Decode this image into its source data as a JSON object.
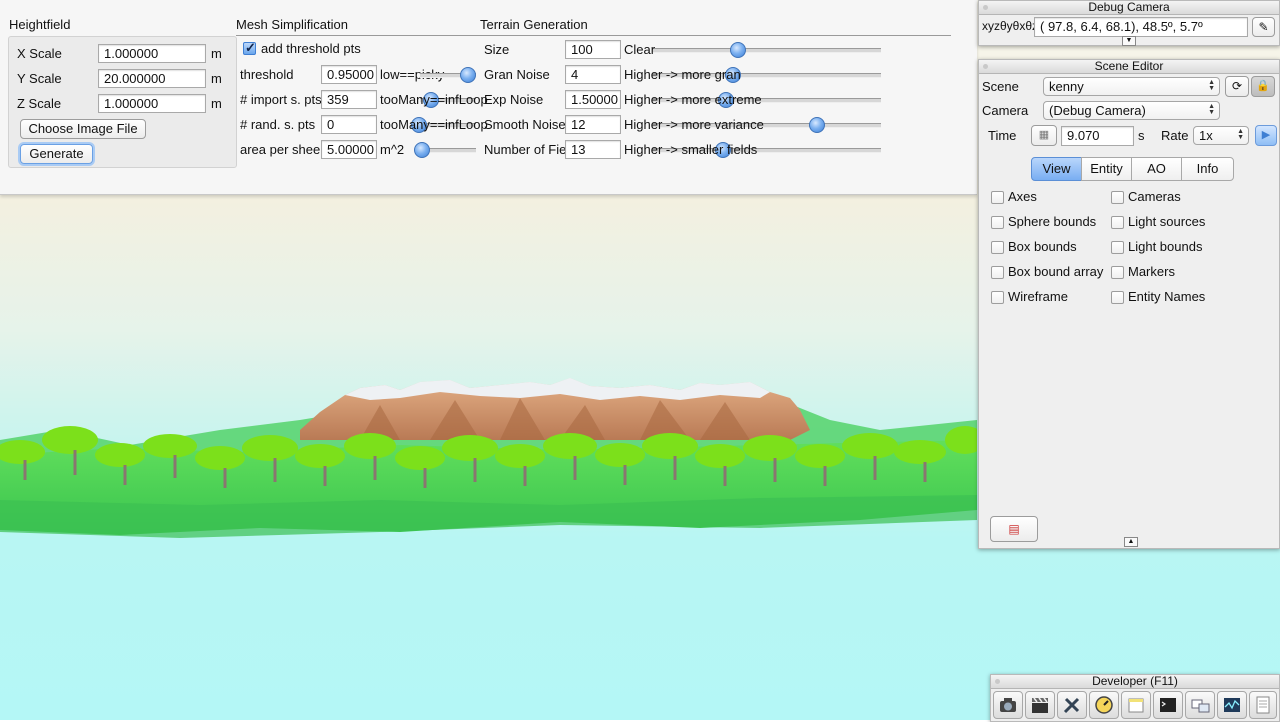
{
  "heightfield": {
    "title": "Heightfield",
    "rows": [
      {
        "label": "X Scale",
        "value": "1.000000",
        "unit": "m"
      },
      {
        "label": "Y Scale",
        "value": "20.000000",
        "unit": "m"
      },
      {
        "label": "Z Scale",
        "value": "1.000000",
        "unit": "m"
      }
    ],
    "choose_label": "Choose Image File",
    "generate_label": "Generate"
  },
  "mesh": {
    "title": "Mesh Simplification",
    "add_threshold_label": "add threshold pts",
    "add_threshold_checked": true,
    "rows": [
      {
        "label": "threshold",
        "value": "0.95000",
        "hint": "low==picky",
        "slider": 0.95
      },
      {
        "label": "# import s. pts",
        "value": "359",
        "hint": "tooMany==infLoop",
        "slider": 0.2
      },
      {
        "label": "# rand. s. pts",
        "value": "0",
        "hint": "tooMany==infLoop",
        "slider": 0.0
      },
      {
        "label": "area per sheep",
        "value": "5.00000",
        "hint": "m^2",
        "slider": 0.0
      }
    ]
  },
  "terrain": {
    "title": "Terrain Generation",
    "rows": [
      {
        "label": "Size",
        "value": "100",
        "hint": "Clear",
        "slider": 0.36
      },
      {
        "label": "Gran Noise",
        "value": "4",
        "hint": "Higher -> more gran",
        "slider": 0.34
      },
      {
        "label": "Exp Noise",
        "value": "1.50000",
        "hint": "Higher -> more extreme",
        "slider": 0.31
      },
      {
        "label": "Smooth Noise",
        "value": "12",
        "hint": "Higher -> more variance",
        "slider": 0.71
      },
      {
        "label": "Number of Fields",
        "value": "13",
        "hint": "Higher -> smaller fields",
        "slider": 0.29
      }
    ]
  },
  "debug_camera": {
    "title": "Debug Camera",
    "xyz_label": "xyzθyθxθz",
    "value": "( 97.8,   6.4,  68.1),  48.5º,   5.7º"
  },
  "scene_editor": {
    "title": "Scene Editor",
    "scene_label": "Scene",
    "scene_value": "kenny",
    "camera_label": "Camera",
    "camera_value": "(Debug Camera)",
    "time_label": "Time",
    "time_value": "9.070",
    "time_unit": "s",
    "rate_label": "Rate",
    "rate_value": "1x",
    "tabs": [
      "View",
      "Entity",
      "AO",
      "Info"
    ],
    "selected_tab": 0,
    "checks_left": [
      "Axes",
      "Sphere bounds",
      "Box bounds",
      "Box bound array",
      "Wireframe"
    ],
    "checks_right": [
      "Cameras",
      "Light sources",
      "Light bounds",
      "Markers",
      "Entity Names"
    ]
  },
  "developer": {
    "title": "Developer (F11)",
    "icons": [
      "camera-icon",
      "clapperboard-icon",
      "tools-icon",
      "speedometer-icon",
      "new-window-icon",
      "terminal-icon",
      "windows-icon",
      "profiler-icon",
      "log-icon"
    ]
  },
  "colors": {
    "accent": "#79aef2",
    "sky_top": "#f7f6ec",
    "sky_bottom": "#b4f7f6",
    "grass": "#44d64b",
    "mountain": "#c88a62"
  }
}
